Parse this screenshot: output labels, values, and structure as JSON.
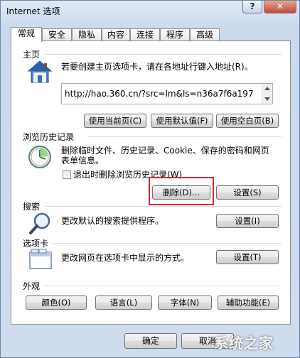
{
  "window": {
    "title": "Internet 选项",
    "help_label": "?",
    "close_label": "✕"
  },
  "tabs": [
    {
      "label": "常规",
      "active": true
    },
    {
      "label": "安全"
    },
    {
      "label": "隐私"
    },
    {
      "label": "内容"
    },
    {
      "label": "连接"
    },
    {
      "label": "程序"
    },
    {
      "label": "高级"
    }
  ],
  "homepage": {
    "section_title": "主页",
    "description": "若要创建主页选项卡，请在各地址行键入地址(R)。",
    "url": "http://hao.360.cn/?src=lm&ls=n36a7f6a197",
    "buttons": {
      "use_current": "使用当前页(C)",
      "use_default": "使用默认值(F)",
      "use_blank": "使用空白页(B)"
    },
    "icon": "house-icon"
  },
  "history": {
    "section_title": "浏览历史记录",
    "description_line1": "删除临时文件、历史记录、Cookie、保存的密码和网页",
    "description_line2": "表单信息。",
    "checkbox_label": "退出时删除浏览历史记录(W)",
    "checkbox_checked": false,
    "delete_button": "删除(D)...",
    "settings_button": "设置(S)",
    "icon": "clock-icon",
    "highlight_color": "#e0262b"
  },
  "search": {
    "section_title": "搜索",
    "description": "更改默认的搜索提供程序。",
    "settings_button": "设置(I)",
    "icon": "magnifier-icon"
  },
  "tabs_section": {
    "section_title": "选项卡",
    "description": "更改网页在选项卡中显示的方式。",
    "settings_button": "设置(T)",
    "icon": "tabs-window-icon"
  },
  "appearance": {
    "section_title": "外观",
    "buttons": {
      "colors": "颜色(O)",
      "languages": "语言(L)",
      "fonts": "字体(N)",
      "accessibility": "辅助功能(E)"
    }
  },
  "footer": {
    "ok": "确定",
    "cancel": "取消"
  },
  "watermark": "系统之家"
}
